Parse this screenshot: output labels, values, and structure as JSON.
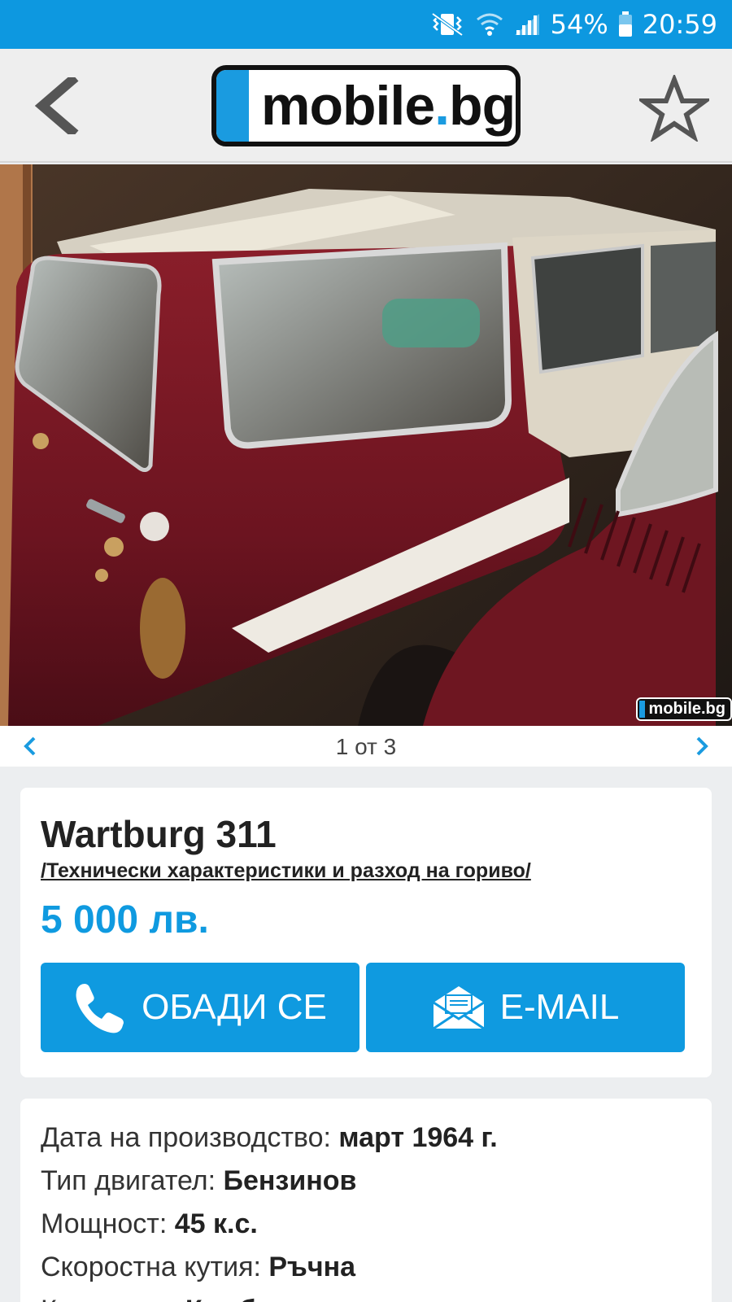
{
  "status_bar": {
    "battery": "54%",
    "time": "20:59",
    "icons": [
      "vibrate-icon",
      "wifi-icon",
      "signal-icon",
      "battery-icon"
    ]
  },
  "app_bar": {
    "logo_main": "mobile",
    "logo_dot": ".",
    "logo_tld": "bg",
    "icons": [
      "back-arrow-icon",
      "star-outline-icon"
    ]
  },
  "photo": {
    "watermark": "mobile.bg"
  },
  "gallery": {
    "counter": "1 от 3",
    "icons": [
      "chevron-left-icon",
      "chevron-right-icon"
    ]
  },
  "listing": {
    "title": "Wartburg 311",
    "spec_link": "/Технически характеристики и разход на гориво/",
    "price": "5 000 лв."
  },
  "actions": {
    "call_label": "ОБАДИ СЕ",
    "email_label": "E-MAIL",
    "icons": [
      "phone-icon",
      "envelope-icon"
    ]
  },
  "details": [
    {
      "label": "Дата на производство: ",
      "value": "март 1964 г."
    },
    {
      "label": "Тип двигател: ",
      "value": "Бензинов"
    },
    {
      "label": "Мощност: ",
      "value": "45 к.с."
    },
    {
      "label": "Скоростна кутия: ",
      "value": "Ръчна"
    },
    {
      "label": "Категория: ",
      "value": "Комби"
    }
  ],
  "colors": {
    "accent": "#0f9ae0",
    "status_bar": "#0d98e0",
    "app_bar": "#eeeeee",
    "background": "#eceef0"
  }
}
